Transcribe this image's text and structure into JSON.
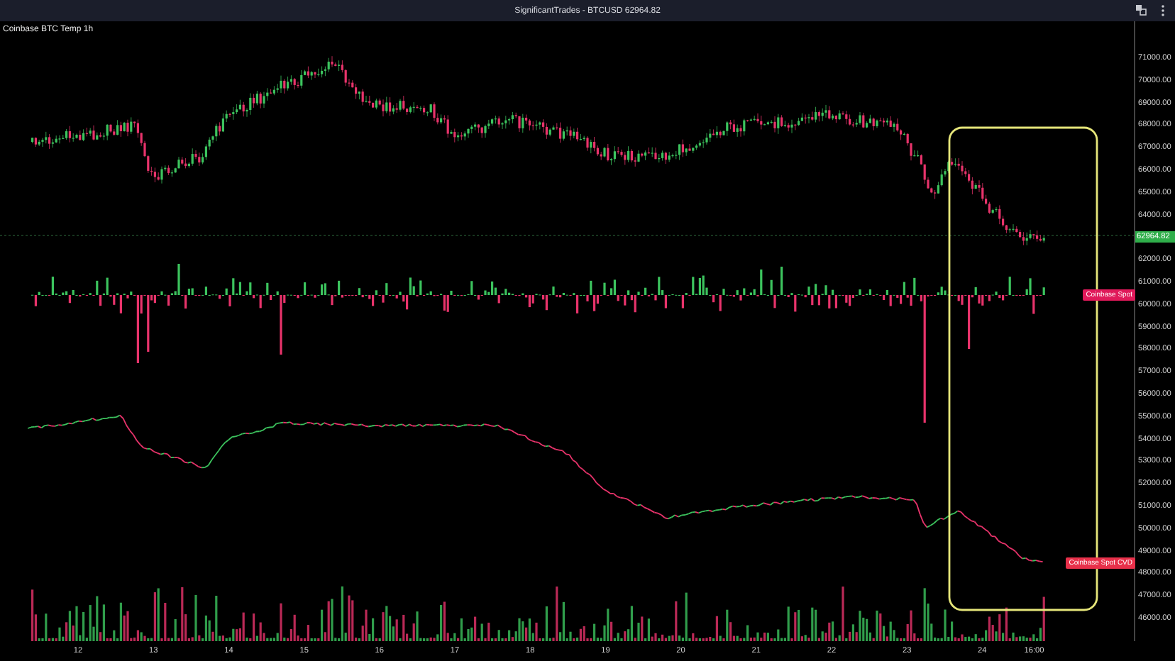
{
  "window": {
    "title": "SignificantTrades - BTCUSD 62964.82"
  },
  "chart": {
    "indicator_label": "Coinbase BTC Temp 1h",
    "series_tags": [
      {
        "label": "Coinbase Spot",
        "color": "#e0195a"
      },
      {
        "label": "Coinbase Spot CVD",
        "color": "#e8304a"
      }
    ]
  },
  "price_axis": {
    "upper_labels": [
      "71000.00",
      "70000.00",
      "69000.00",
      "68000.00",
      "67000.00",
      "66000.00",
      "65000.00",
      "64000.00"
    ],
    "price_tag": "62964.82",
    "lower_labels": [
      "62000.00",
      "61000.00",
      "60000.00",
      "59000.00",
      "58000.00",
      "57000.00",
      "56000.00",
      "55000.00",
      "54000.00",
      "53000.00",
      "52000.00",
      "51000.00",
      "50000.00",
      "49000.00",
      "48000.00",
      "47000.00",
      "46000.00"
    ]
  },
  "time_axis": {
    "labels": [
      "12",
      "13",
      "14",
      "15",
      "16",
      "17",
      "18",
      "19",
      "20",
      "21",
      "22",
      "23",
      "24",
      "16:00"
    ]
  }
}
